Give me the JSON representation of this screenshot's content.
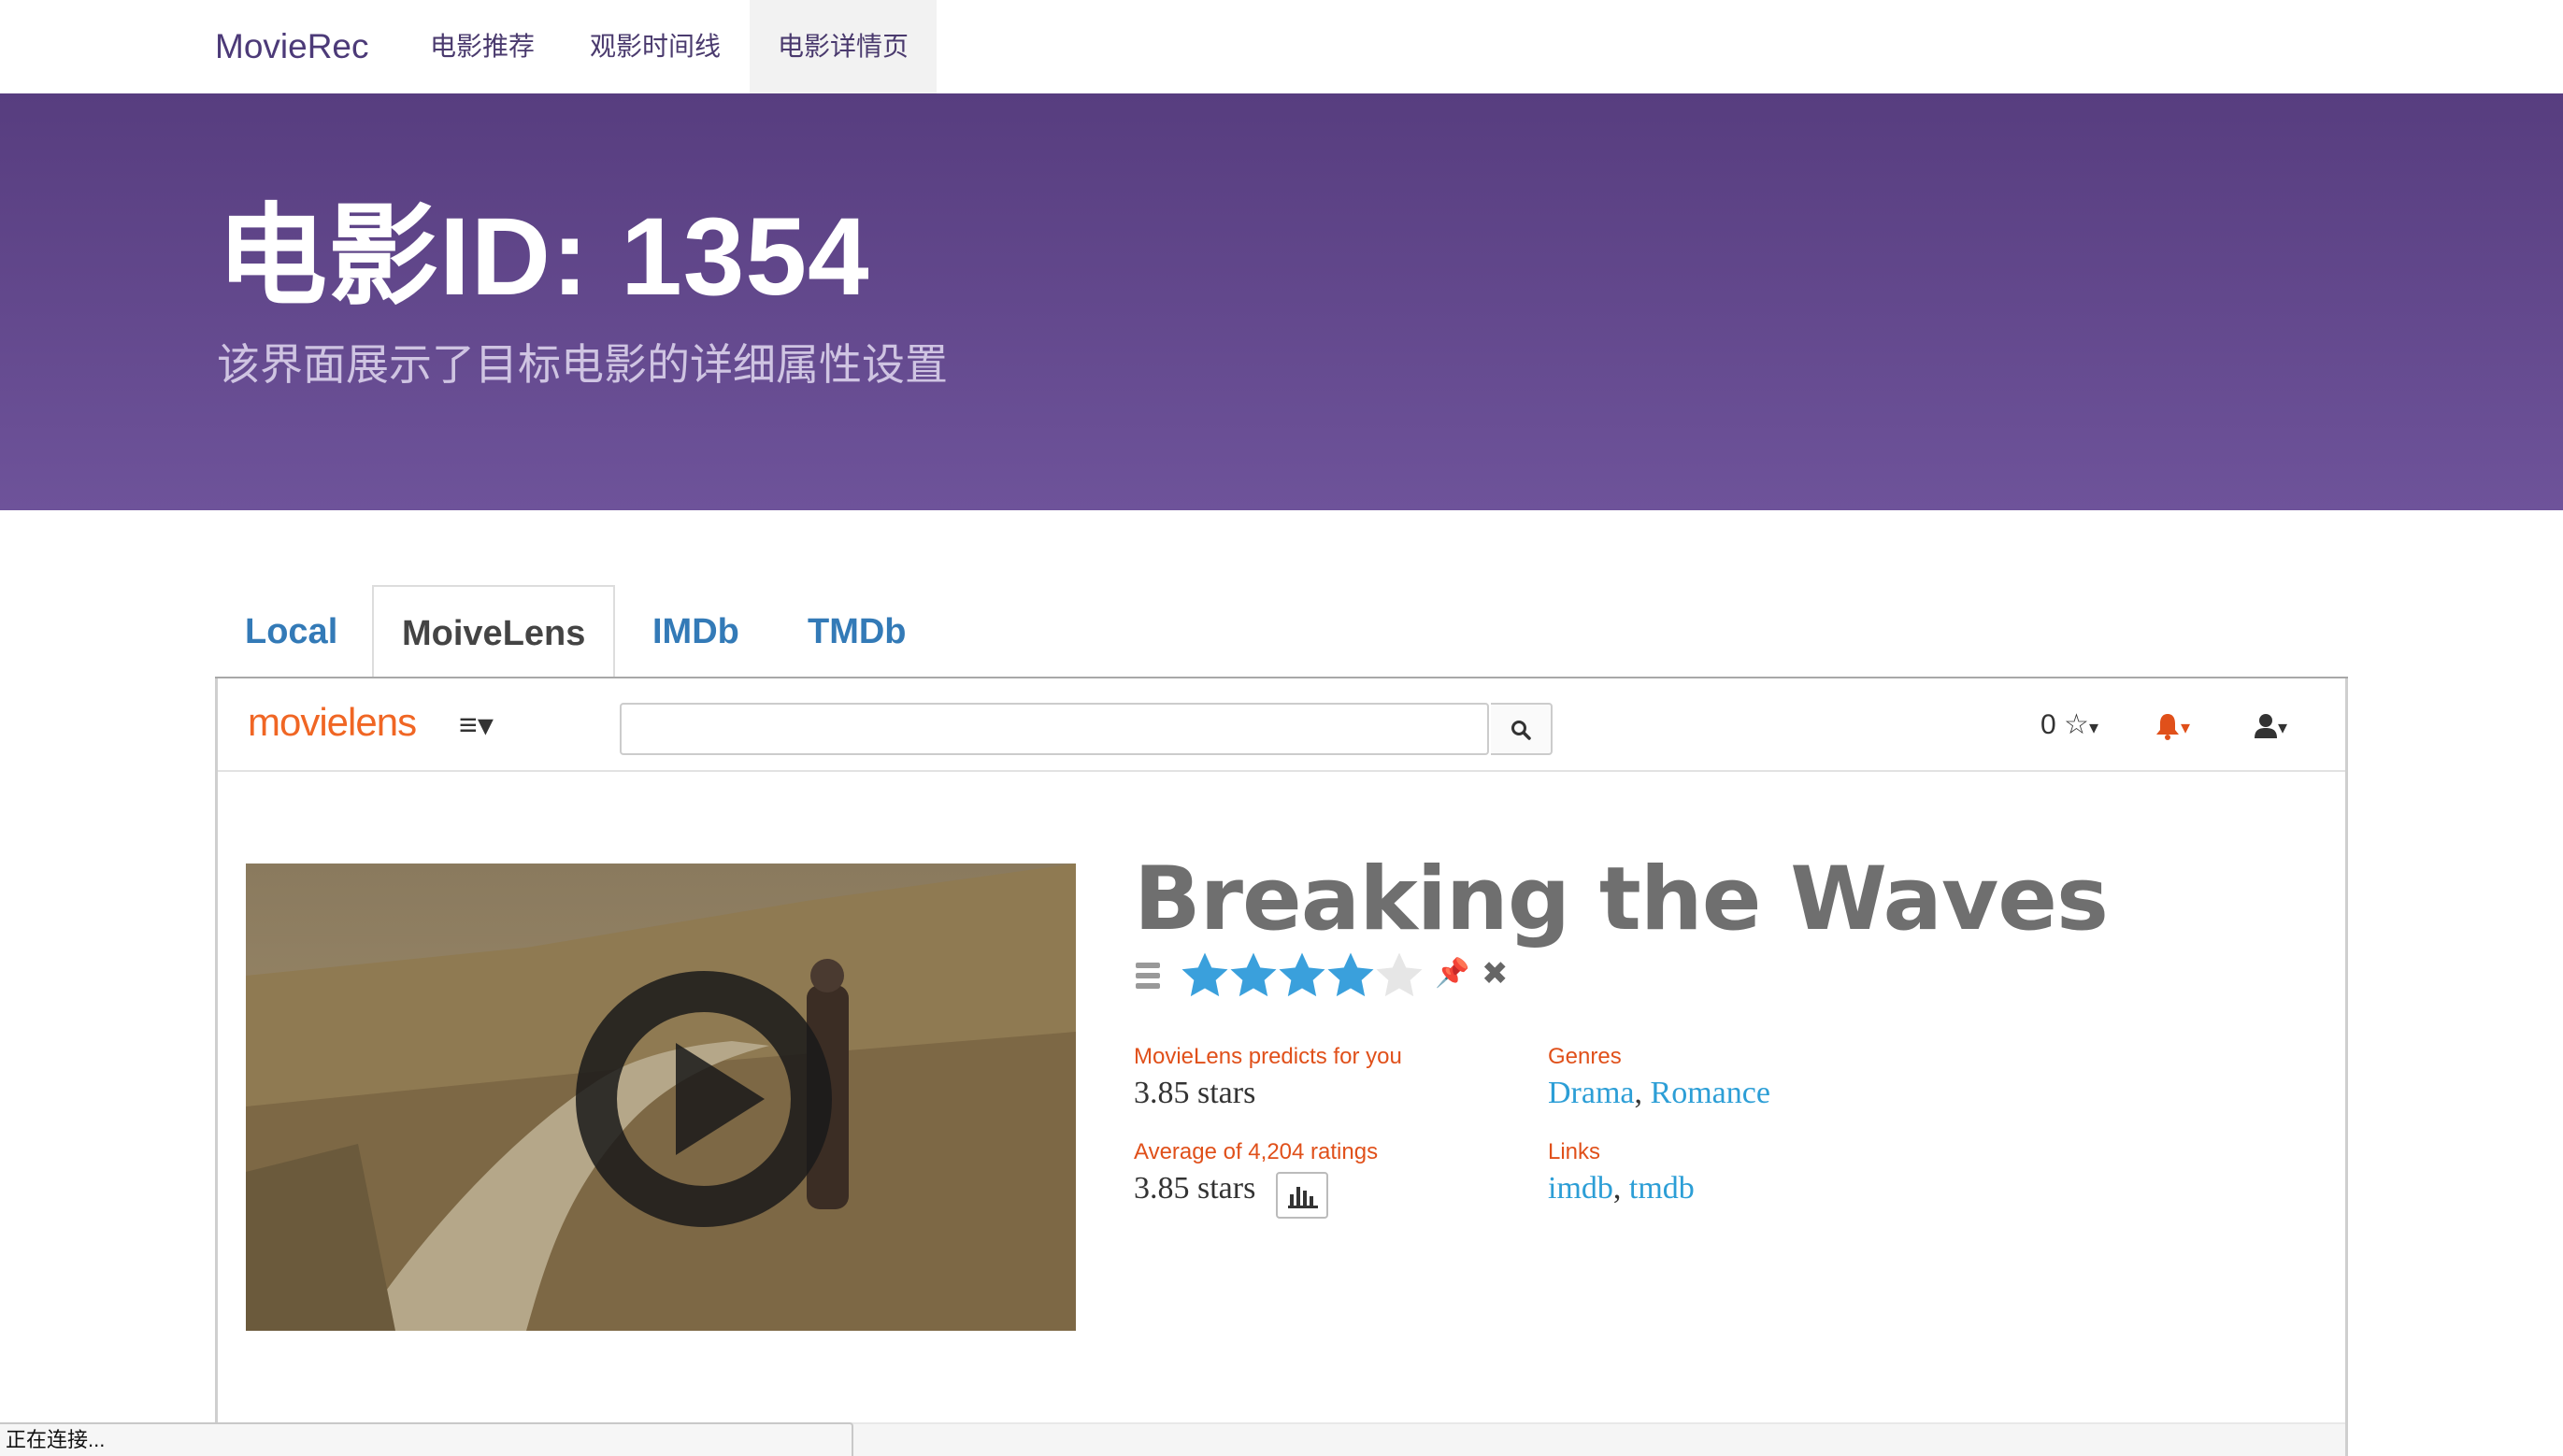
{
  "navbar": {
    "brand": "MovieRec",
    "items": [
      {
        "label": "电影推荐"
      },
      {
        "label": "观影时间线"
      },
      {
        "label": "电影详情页"
      }
    ]
  },
  "hero": {
    "title": "电影ID: 1354",
    "subtitle": "该界面展示了目标电影的详细属性设置"
  },
  "tabs": [
    {
      "label": "Local"
    },
    {
      "label": "MoiveLens"
    },
    {
      "label": "IMDb"
    },
    {
      "label": "TMDb"
    }
  ],
  "movielens": {
    "logo": "movielens",
    "search_value": "",
    "rating_count_label": "0",
    "colors": {
      "brand": "#f06624",
      "star": "#3aa0dc",
      "link": "#2c9ed6"
    }
  },
  "movie": {
    "title": "Breaking the Waves",
    "user_rating_stars": 4,
    "max_stars": 5,
    "predict_label": "MovieLens predicts for you",
    "predict_value": "3.85 stars",
    "average_label": "Average of 4,204 ratings",
    "average_value": "3.85 stars",
    "genres_label": "Genres",
    "genres": [
      "Drama",
      "Romance"
    ],
    "links_label": "Links",
    "links": [
      "imdb",
      "tmdb"
    ]
  },
  "status_bar": {
    "text": "正在连接..."
  }
}
